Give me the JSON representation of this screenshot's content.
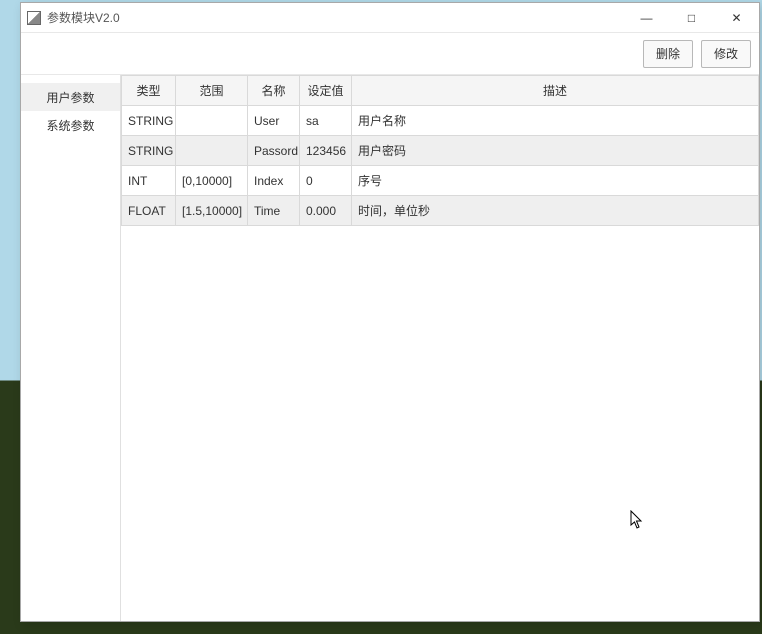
{
  "window": {
    "title": "参数模块V2.0"
  },
  "win_controls": {
    "minimize": "—",
    "maximize": "□",
    "close": "✕"
  },
  "toolbar": {
    "delete_label": "删除",
    "edit_label": "修改"
  },
  "sidebar": {
    "items": [
      {
        "label": "用户参数",
        "active": true
      },
      {
        "label": "系统参数",
        "active": false
      }
    ]
  },
  "table": {
    "headers": {
      "type": "类型",
      "range": "范围",
      "name": "名称",
      "value": "设定值",
      "desc": "描述"
    },
    "rows": [
      {
        "type": "STRING",
        "range": "",
        "name": "User",
        "value": "sa",
        "desc": "用户名称"
      },
      {
        "type": "STRING",
        "range": "",
        "name": "Passord",
        "value": "123456",
        "desc": "用户密码"
      },
      {
        "type": "INT",
        "range": "[0,10000]",
        "name": "Index",
        "value": "0",
        "desc": "序号"
      },
      {
        "type": "FLOAT",
        "range": "[1.5,10000]",
        "name": "Time",
        "value": "0.000",
        "desc": "时间，单位秒"
      }
    ]
  }
}
